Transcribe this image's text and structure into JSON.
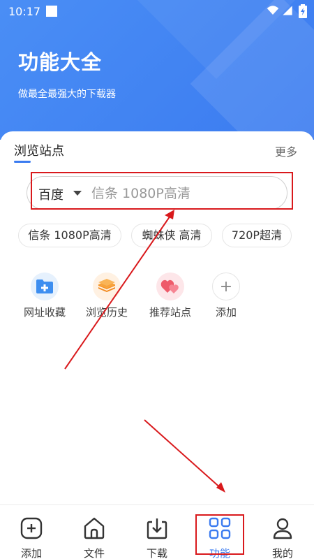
{
  "status_bar": {
    "time": "10:17"
  },
  "header": {
    "title": "功能大全",
    "subtitle": "做最全最强大的下载器"
  },
  "browse": {
    "section_title": "浏览站点",
    "more_label": "更多",
    "search": {
      "engine": "百度",
      "placeholder": "信条 1080P高清"
    },
    "chips": [
      "信条 1080P高清",
      "蜘蛛侠 高清",
      "720P超清"
    ],
    "shortcuts": [
      {
        "label": "网址收藏",
        "icon": "folder-add-icon"
      },
      {
        "label": "浏览历史",
        "icon": "layers-icon"
      },
      {
        "label": "推荐站点",
        "icon": "hearts-icon"
      },
      {
        "label": "添加",
        "icon": "plus-icon"
      }
    ]
  },
  "bottom_nav": {
    "items": [
      {
        "label": "添加",
        "icon": "add-square-icon"
      },
      {
        "label": "文件",
        "icon": "home-icon"
      },
      {
        "label": "下载",
        "icon": "download-icon"
      },
      {
        "label": "功能",
        "icon": "grid-icon",
        "active": true
      },
      {
        "label": "我的",
        "icon": "user-icon"
      }
    ]
  },
  "colors": {
    "accent": "#3b7bf0",
    "annotation": "#d9191c",
    "header_bg": "#4a8ef5"
  }
}
